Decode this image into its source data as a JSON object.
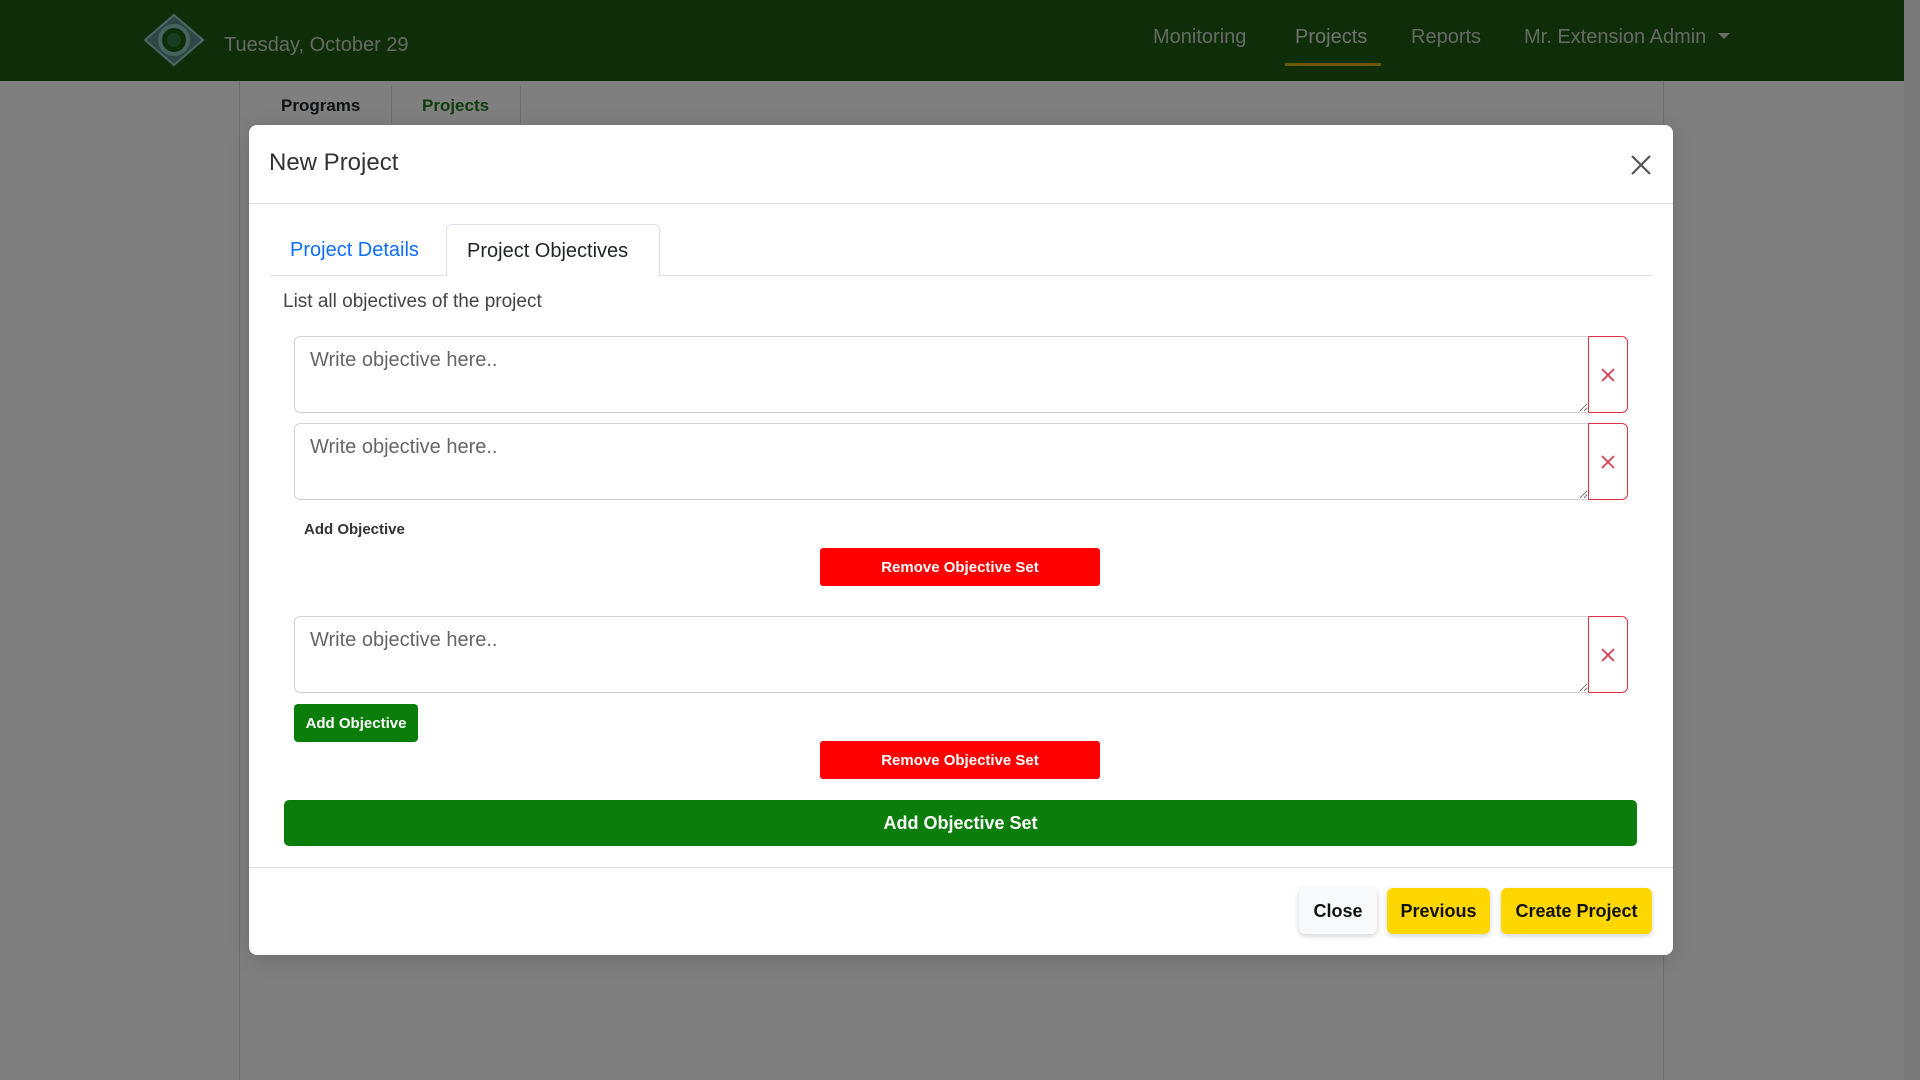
{
  "navbar": {
    "date": "Tuesday, October 29",
    "links": [
      "Monitoring",
      "Projects",
      "Reports"
    ],
    "user": "Mr. Extension Admin",
    "bg_color": "#1e5a12"
  },
  "background_page": {
    "tabs": [
      "Programs",
      "Projects"
    ]
  },
  "modal": {
    "title": "New Project",
    "tabs": [
      "Project Details",
      "Project Objectives"
    ],
    "active_tab": "Project Objectives",
    "instructions": "List all objectives of the project",
    "objective_placeholder": "Write objective here..",
    "add_objective_label": "Add Objective",
    "remove_set_label": "Remove Objective Set",
    "add_set_label": "Add Objective Set",
    "footer": {
      "close": "Close",
      "previous": "Previous",
      "create": "Create Project"
    }
  },
  "colors": {
    "green": "#0a7d0a",
    "red": "#ff0000",
    "yellow": "#ffd700",
    "link_blue": "#0d6efd"
  }
}
